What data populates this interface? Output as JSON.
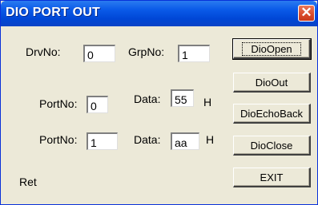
{
  "window": {
    "title": "DIO PORT OUT",
    "close_glyph": "✕"
  },
  "drv": {
    "label": "DrvNo:",
    "value": "0"
  },
  "grp": {
    "label": "GrpNo:",
    "value": "1"
  },
  "port1": {
    "label": "PortNo:",
    "value": "0"
  },
  "data1": {
    "label": "Data:",
    "value": "55",
    "suffix": "H"
  },
  "port2": {
    "label": "PortNo:",
    "value": "1"
  },
  "data2": {
    "label": "Data:",
    "value": "aa",
    "suffix": "H"
  },
  "ret": {
    "label": "Ret"
  },
  "buttons": {
    "dio_open": "DioOpen",
    "dio_out": "DioOut",
    "dio_echo_back": "DioEchoBack",
    "dio_close": "DioClose",
    "exit": "EXIT"
  }
}
